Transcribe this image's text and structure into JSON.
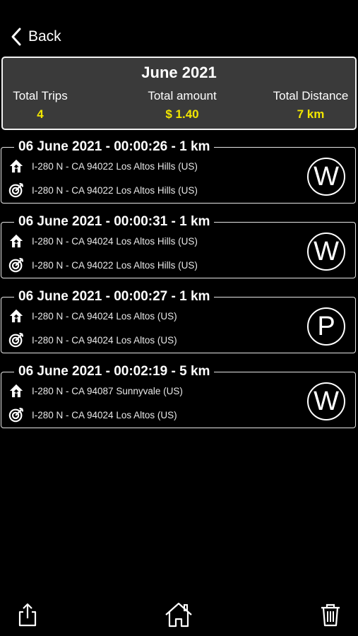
{
  "nav": {
    "back_label": "Back"
  },
  "summary": {
    "title": "June 2021",
    "total_trips_label": "Total Trips",
    "total_trips_value": "4",
    "total_amount_label": "Total amount",
    "total_amount_value": "$ 1.40",
    "total_distance_label": "Total Distance",
    "total_distance_value": "7 km"
  },
  "trips": [
    {
      "header": "06 June 2021 - 00:00:26 - 1 km",
      "from": "I-280 N - CA 94022 Los Altos Hills (US)",
      "to": "I-280 N - CA 94022 Los Altos Hills (US)",
      "badge": "W"
    },
    {
      "header": "06 June 2021 - 00:00:31 - 1 km",
      "from": "I-280 N - CA 94024 Los Altos Hills (US)",
      "to": "I-280 N - CA 94022 Los Altos Hills (US)",
      "badge": "W"
    },
    {
      "header": "06 June 2021 - 00:00:27 - 1 km",
      "from": "I-280 N - CA 94024 Los Altos (US)",
      "to": "I-280 N - CA 94024 Los Altos (US)",
      "badge": "P"
    },
    {
      "header": "06 June 2021 - 00:02:19 - 5 km",
      "from": "I-280 N - CA 94087 Sunnyvale (US)",
      "to": "I-280 N - CA 94024 Los Altos (US)",
      "badge": "W"
    }
  ],
  "toolbar": {
    "share_icon": "share-icon",
    "home_icon": "home-icon",
    "trash_icon": "trash-icon"
  },
  "colors": {
    "background": "#000000",
    "summary_bg": "#3a3a3a",
    "accent_yellow": "#f2e600"
  }
}
